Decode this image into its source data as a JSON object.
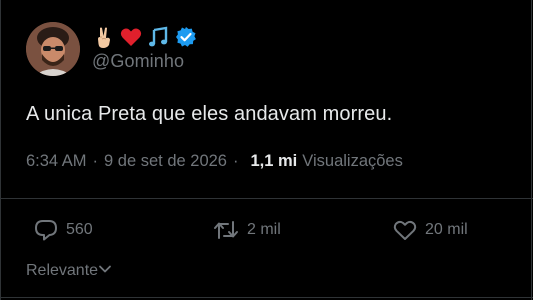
{
  "author": {
    "handle": "@Gominho",
    "emojis": [
      "victory-hand-icon",
      "red-heart-icon",
      "musical-notes-icon"
    ],
    "verified": true,
    "accent_color": "#1d9bf0"
  },
  "tweet": {
    "text": "A unica Preta que eles andavam morreu."
  },
  "meta": {
    "time": "6:34 AM",
    "separator1": "·",
    "date": "9 de set de 2026",
    "separator2": "·",
    "views_count": "1,1 mi",
    "views_label": "Visualizações"
  },
  "actions": {
    "replies": "560",
    "reposts": "2 mil",
    "likes": "20 mil"
  },
  "sort": {
    "label": "Relevante"
  },
  "colors": {
    "background": "#000000",
    "text": "#e7e9ea",
    "muted": "#71767b",
    "border": "#2f3336",
    "heart": "#f91880",
    "verified": "#1d9bf0"
  }
}
